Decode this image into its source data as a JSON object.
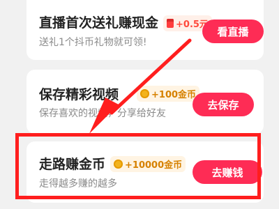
{
  "tasks": [
    {
      "title": "直播首次送礼赚现金",
      "reward": "+0.5元",
      "reward_icon": "red-packet-icon",
      "subtitle": "送礼1个抖币礼物就可领!",
      "button": "看直播"
    },
    {
      "title": "保存精彩视频",
      "reward": "+100金币",
      "reward_icon": "coin-icon",
      "subtitle": "保存喜欢的视频，分享给好友",
      "button": "去保存"
    },
    {
      "title": "走路赚金币",
      "reward": "+10000金币",
      "reward_icon": "coin-icon",
      "subtitle": "走得越多赚的越多",
      "button": "去赚钱"
    }
  ],
  "annotation": {
    "highlight_color": "#ff1e1e",
    "arrow_color": "#ff1e1e",
    "highlighted_task": "走路赚金币"
  },
  "colors": {
    "button": "#fe2c55",
    "coin_reward": "#d68100",
    "cash_reward": "#ff4a3c"
  }
}
